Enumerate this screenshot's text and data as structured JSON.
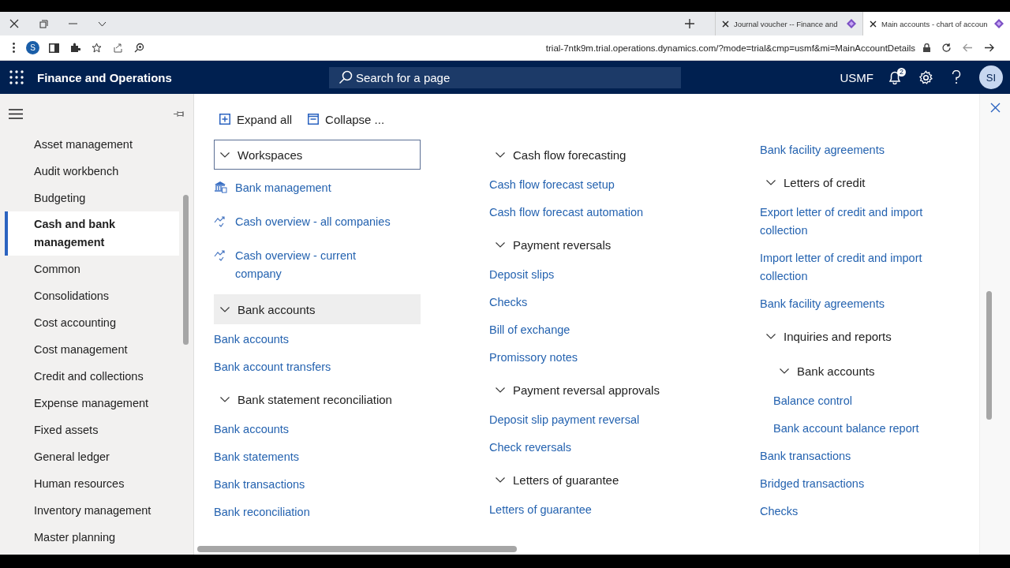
{
  "browser": {
    "tabs": [
      {
        "title": "Journal voucher -- Finance and",
        "selected": false
      },
      {
        "title": "Main accounts - chart of accoun",
        "selected": true
      }
    ],
    "address": "trial-7ntk9m.trial.operations.dynamics.com/?mode=trial&cmp=usmf&mi=MainAccountDetails",
    "profile": "S"
  },
  "app": {
    "title": "Finance and Operations",
    "search": {
      "placeholder": "Search for a page"
    },
    "company": "USMF",
    "notifications": "2",
    "avatar": "SI"
  },
  "sidebar": {
    "items": [
      {
        "label": "Asset management",
        "selected": false
      },
      {
        "label": "Audit workbench",
        "selected": false
      },
      {
        "label": "Budgeting",
        "selected": false
      },
      {
        "label": "Cash and bank management",
        "selected": true
      },
      {
        "label": "Common",
        "selected": false
      },
      {
        "label": "Consolidations",
        "selected": false
      },
      {
        "label": "Cost accounting",
        "selected": false
      },
      {
        "label": "Cost management",
        "selected": false
      },
      {
        "label": "Credit and collections",
        "selected": false
      },
      {
        "label": "Expense management",
        "selected": false
      },
      {
        "label": "Fixed assets",
        "selected": false
      },
      {
        "label": "General ledger",
        "selected": false
      },
      {
        "label": "Human resources",
        "selected": false
      },
      {
        "label": "Inventory management",
        "selected": false
      },
      {
        "label": "Master planning",
        "selected": false
      }
    ]
  },
  "toolbar": {
    "expand_all": "Expand all",
    "collapse_all": "Collapse ..."
  },
  "columns": [
    {
      "items": [
        {
          "kind": "group",
          "title": "Workspaces",
          "expanded": true,
          "focused": true,
          "hovered": false,
          "children": [
            {
              "kind": "bank-tile",
              "label": "Bank management"
            },
            {
              "kind": "chart-tile",
              "label": "Cash overview - all companies"
            },
            {
              "kind": "chart-tile",
              "label": "Cash overview - current company"
            }
          ]
        },
        {
          "kind": "group",
          "title": "Bank accounts",
          "expanded": true,
          "focused": false,
          "hovered": true,
          "children": [
            {
              "kind": "link",
              "label": "Bank accounts"
            },
            {
              "kind": "link",
              "label": "Bank account transfers"
            }
          ]
        },
        {
          "kind": "group",
          "title": "Bank statement reconciliation",
          "expanded": true,
          "focused": false,
          "hovered": false,
          "children": [
            {
              "kind": "link",
              "label": "Bank accounts"
            },
            {
              "kind": "link",
              "label": "Bank statements"
            },
            {
              "kind": "link",
              "label": "Bank transactions"
            },
            {
              "kind": "link",
              "label": "Bank reconciliation"
            }
          ]
        }
      ]
    },
    {
      "items": [
        {
          "kind": "group",
          "title": "Cash flow forecasting",
          "expanded": true,
          "focused": false,
          "hovered": false,
          "children": [
            {
              "kind": "link",
              "label": "Cash flow forecast setup"
            },
            {
              "kind": "link",
              "label": "Cash flow forecast automation"
            }
          ]
        },
        {
          "kind": "group",
          "title": "Payment reversals",
          "expanded": true,
          "focused": false,
          "hovered": false,
          "children": [
            {
              "kind": "link",
              "label": "Deposit slips"
            },
            {
              "kind": "link",
              "label": "Checks"
            },
            {
              "kind": "link",
              "label": "Bill of exchange"
            },
            {
              "kind": "link",
              "label": "Promissory notes"
            }
          ]
        },
        {
          "kind": "group",
          "title": "Payment reversal approvals",
          "expanded": true,
          "focused": false,
          "hovered": false,
          "children": [
            {
              "kind": "link",
              "label": "Deposit slip payment reversal"
            },
            {
              "kind": "link",
              "label": "Check reversals"
            }
          ]
        },
        {
          "kind": "group",
          "title": "Letters of guarantee",
          "expanded": true,
          "focused": false,
          "hovered": false,
          "children": [
            {
              "kind": "link",
              "label": "Letters of guarantee"
            }
          ]
        }
      ]
    },
    {
      "items": [
        {
          "kind": "link",
          "label": "Bank facility agreements"
        },
        {
          "kind": "group",
          "title": "Letters of credit",
          "expanded": true,
          "focused": false,
          "hovered": false,
          "children": [
            {
              "kind": "link",
              "label": "Export letter of credit and import collection"
            },
            {
              "kind": "link",
              "label": "Import letter of credit and import collection"
            },
            {
              "kind": "link",
              "label": "Bank facility agreements"
            }
          ]
        },
        {
          "kind": "group",
          "title": "Inquiries and reports",
          "expanded": true,
          "focused": false,
          "hovered": false,
          "children": [
            {
              "kind": "group",
              "title": "Bank accounts",
              "expanded": true,
              "focused": false,
              "hovered": false,
              "children": [
                {
                  "kind": "link",
                  "label": "Balance control"
                },
                {
                  "kind": "link",
                  "label": "Bank account balance report"
                }
              ]
            },
            {
              "kind": "link",
              "label": "Bank transactions"
            },
            {
              "kind": "link",
              "label": "Bridged transactions"
            },
            {
              "kind": "link",
              "label": "Checks"
            }
          ]
        }
      ]
    }
  ]
}
